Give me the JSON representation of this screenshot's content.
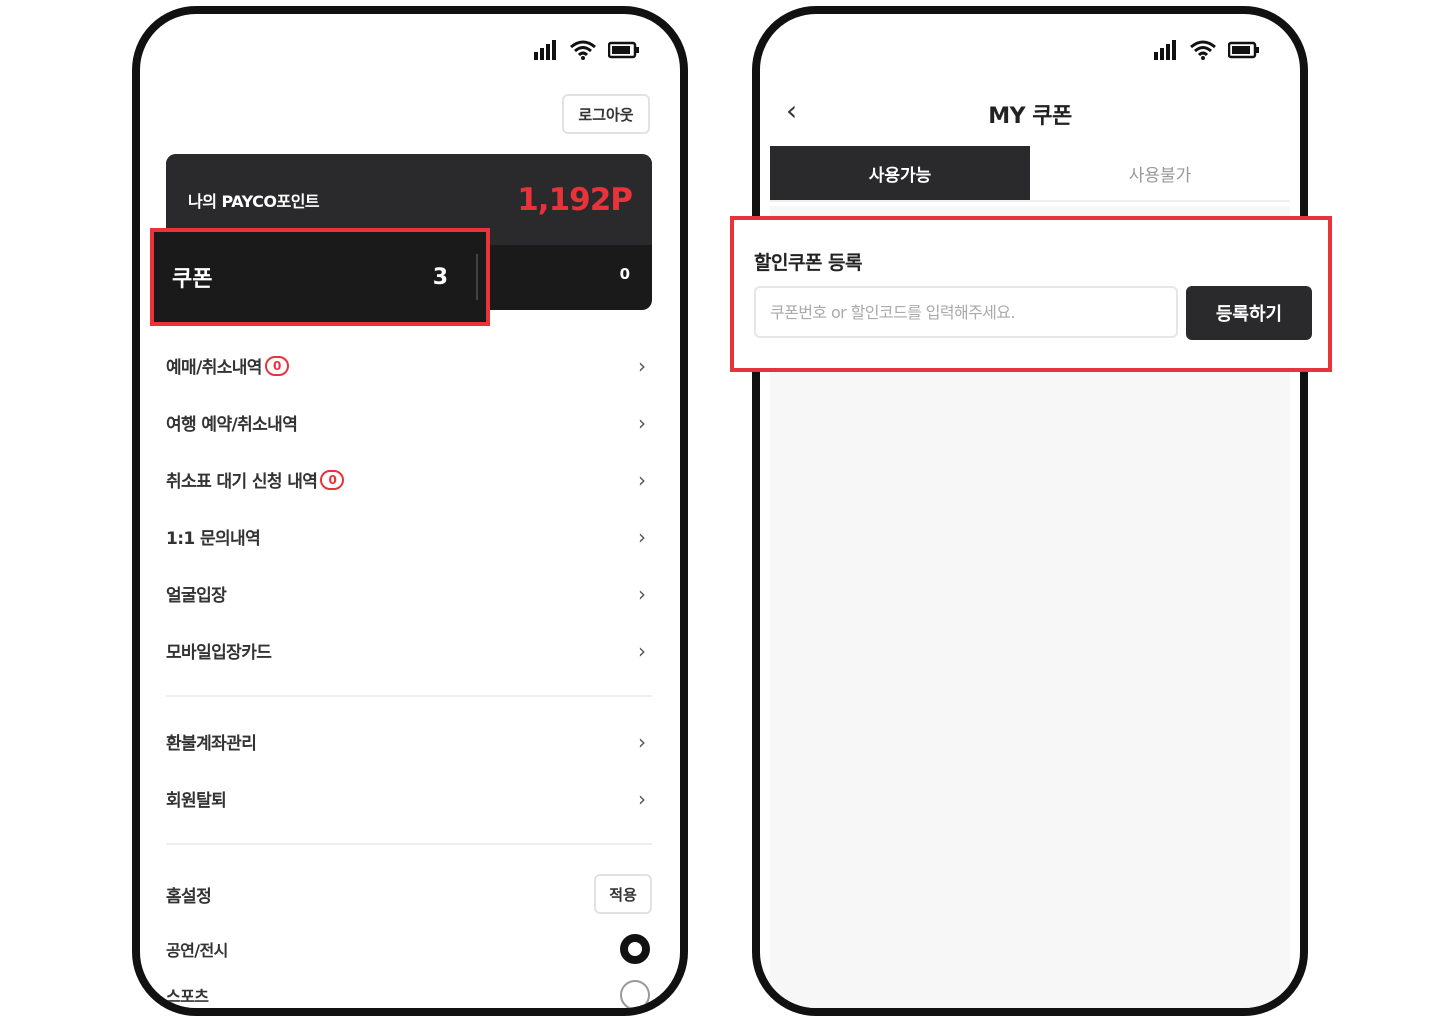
{
  "left_screen": {
    "logout_label": "로그아웃",
    "points": {
      "label": "나의 PAYCO포인트",
      "value": "1,192P"
    },
    "coupon": {
      "label": "쿠폰",
      "count": "3"
    },
    "other_count": "0",
    "menu_group_1": [
      {
        "label": "예매/취소내역",
        "badge": "0"
      },
      {
        "label": "여행 예약/취소내역",
        "badge": null
      },
      {
        "label": "취소표 대기 신청 내역",
        "badge": "0"
      },
      {
        "label": "1:1 문의내역",
        "badge": null
      },
      {
        "label": "얼굴입장",
        "badge": null
      },
      {
        "label": "모바일입장카드",
        "badge": null
      }
    ],
    "menu_group_2": [
      {
        "label": "환불계좌관리"
      },
      {
        "label": "회원탈퇴"
      }
    ],
    "home_setting": {
      "label": "홈설정",
      "apply_label": "적용"
    },
    "home_options": [
      {
        "label": "공연/전시",
        "selected": true
      },
      {
        "label": "스포츠",
        "selected": false
      }
    ]
  },
  "right_screen": {
    "title": "MY 쿠폰",
    "tabs": [
      {
        "label": "사용가능",
        "active": true
      },
      {
        "label": "사용불가",
        "active": false
      }
    ],
    "register": {
      "title": "할인쿠폰 등록",
      "placeholder": "쿠폰번호 or 할인코드를 입력해주세요.",
      "button_label": "등록하기"
    }
  },
  "colors": {
    "accent": "#e8333a",
    "dark": "#2a2a2c"
  }
}
